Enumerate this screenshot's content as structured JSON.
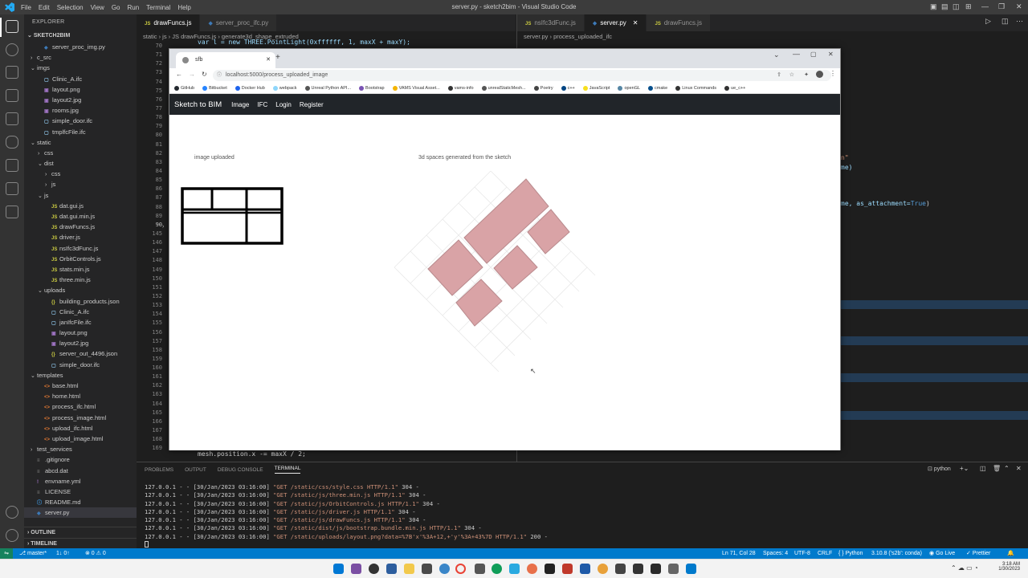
{
  "window": {
    "title": "server.py - sketch2bim - Visual Studio Code",
    "menu": [
      "File",
      "Edit",
      "Selection",
      "View",
      "Go",
      "Run",
      "Terminal",
      "Help"
    ]
  },
  "explorer": {
    "header": "EXPLORER",
    "root": "SKETCH2BIM",
    "items": [
      {
        "label": "server_proc_img.py",
        "indent": 1,
        "kind": "py",
        "chev": ""
      },
      {
        "label": "c_src",
        "indent": 0,
        "kind": "folder",
        "chev": "›"
      },
      {
        "label": "imgs",
        "indent": 0,
        "kind": "folder",
        "chev": "⌄"
      },
      {
        "label": "Clinic_A.ifc",
        "indent": 1,
        "kind": "ifc",
        "chev": ""
      },
      {
        "label": "layout.png",
        "indent": 1,
        "kind": "img",
        "chev": ""
      },
      {
        "label": "layout2.jpg",
        "indent": 1,
        "kind": "img",
        "chev": ""
      },
      {
        "label": "rooms.jpg",
        "indent": 1,
        "kind": "img",
        "chev": ""
      },
      {
        "label": "simple_door.ifc",
        "indent": 1,
        "kind": "ifc",
        "chev": ""
      },
      {
        "label": "tmplfcFile.ifc",
        "indent": 1,
        "kind": "ifc",
        "chev": ""
      },
      {
        "label": "static",
        "indent": 0,
        "kind": "folder",
        "chev": "⌄"
      },
      {
        "label": "css",
        "indent": 1,
        "kind": "folder",
        "chev": "›"
      },
      {
        "label": "dist",
        "indent": 1,
        "kind": "folder",
        "chev": "⌄"
      },
      {
        "label": "css",
        "indent": 2,
        "kind": "folder",
        "chev": "›"
      },
      {
        "label": "js",
        "indent": 2,
        "kind": "folder",
        "chev": "›"
      },
      {
        "label": "js",
        "indent": 1,
        "kind": "folder",
        "chev": "⌄"
      },
      {
        "label": "dat.gui.js",
        "indent": 2,
        "kind": "js",
        "chev": ""
      },
      {
        "label": "dat.gui.min.js",
        "indent": 2,
        "kind": "js",
        "chev": ""
      },
      {
        "label": "drawFuncs.js",
        "indent": 2,
        "kind": "js",
        "chev": ""
      },
      {
        "label": "driver.js",
        "indent": 2,
        "kind": "js",
        "chev": ""
      },
      {
        "label": "nsIfc3dFunc.js",
        "indent": 2,
        "kind": "js",
        "chev": ""
      },
      {
        "label": "OrbitControls.js",
        "indent": 2,
        "kind": "js",
        "chev": ""
      },
      {
        "label": "stats.min.js",
        "indent": 2,
        "kind": "js",
        "chev": ""
      },
      {
        "label": "three.min.js",
        "indent": 2,
        "kind": "js",
        "chev": ""
      },
      {
        "label": "uploads",
        "indent": 1,
        "kind": "folder",
        "chev": "⌄"
      },
      {
        "label": "building_products.json",
        "indent": 2,
        "kind": "json",
        "chev": ""
      },
      {
        "label": "Clinic_A.ifc",
        "indent": 2,
        "kind": "ifc",
        "chev": ""
      },
      {
        "label": "janIfcFile.ifc",
        "indent": 2,
        "kind": "ifc",
        "chev": ""
      },
      {
        "label": "layout.png",
        "indent": 2,
        "kind": "img",
        "chev": ""
      },
      {
        "label": "layout2.jpg",
        "indent": 2,
        "kind": "img",
        "chev": ""
      },
      {
        "label": "server_out_4496.json",
        "indent": 2,
        "kind": "json",
        "chev": ""
      },
      {
        "label": "simple_door.ifc",
        "indent": 2,
        "kind": "ifc",
        "chev": ""
      },
      {
        "label": "templates",
        "indent": 0,
        "kind": "folder",
        "chev": "⌄"
      },
      {
        "label": "base.html",
        "indent": 1,
        "kind": "html",
        "chev": ""
      },
      {
        "label": "home.html",
        "indent": 1,
        "kind": "html",
        "chev": ""
      },
      {
        "label": "process_ifc.html",
        "indent": 1,
        "kind": "html",
        "chev": ""
      },
      {
        "label": "process_image.html",
        "indent": 1,
        "kind": "html",
        "chev": ""
      },
      {
        "label": "upload_ifc.html",
        "indent": 1,
        "kind": "html",
        "chev": ""
      },
      {
        "label": "upload_image.html",
        "indent": 1,
        "kind": "html",
        "chev": ""
      },
      {
        "label": "test_services",
        "indent": 0,
        "kind": "folder",
        "chev": "›"
      },
      {
        "label": ".gitignore",
        "indent": 0,
        "kind": "txt",
        "chev": ""
      },
      {
        "label": "abcd.dat",
        "indent": 0,
        "kind": "txt",
        "chev": ""
      },
      {
        "label": "envname.yml",
        "indent": 0,
        "kind": "yml",
        "chev": ""
      },
      {
        "label": "LICENSE",
        "indent": 0,
        "kind": "txt",
        "chev": ""
      },
      {
        "label": "README.md",
        "indent": 0,
        "kind": "md",
        "chev": ""
      },
      {
        "label": "server.py",
        "indent": 0,
        "kind": "py",
        "chev": "",
        "selected": true
      }
    ],
    "outline": "OUTLINE",
    "timeline": "TIMELINE"
  },
  "editor_left": {
    "tabs": [
      {
        "label": "drawFuncs.js",
        "kind": "js",
        "active": true
      },
      {
        "label": "server_proc_ifc.py",
        "kind": "py",
        "active": false
      }
    ],
    "breadcrumb": "static › js › JS drawFuncs.js › generate3d_shape_extruded",
    "line_numbers": [
      "70",
      "71",
      "72",
      "73",
      "74",
      "75",
      "76",
      "77",
      "78",
      "79",
      "80",
      "81",
      "82",
      "83",
      "84",
      "85",
      "86",
      "87",
      "88",
      "89",
      "90",
      "145",
      "146",
      "147",
      "148",
      "149",
      "150",
      "151",
      "152",
      "153",
      "154",
      "155",
      "156",
      "157",
      "158",
      "159",
      "160",
      "161",
      "162",
      "163",
      "164",
      "165",
      "166",
      "167",
      "168",
      "169"
    ],
    "top_code": "var l = new THREE.PointLight(0xffffff, 1, maxX + maxY);",
    "bottom_code": "mesh.position.x -= maxX / 2;"
  },
  "editor_right": {
    "tabs": [
      {
        "label": "nsIfc3dFunc.js",
        "kind": "js",
        "active": false
      },
      {
        "label": "server.py",
        "kind": "py",
        "active": true
      },
      {
        "label": "drawFuncs.js",
        "kind": "js",
        "active": false
      }
    ],
    "breadcrumb": "server.py › process_uploaded_ifc",
    "snippet_1": "n\"",
    "snippet_2": "me)",
    "snippet_3a": "me, as_attachment=",
    "snippet_3b": "True",
    "snippet_3c": ")"
  },
  "browser": {
    "tab_title": "sfb",
    "url": "localhost:5000/process_uploaded_image",
    "bookmarks": [
      "GitHub",
      "Bitbucket",
      "Docker Hub",
      "webpack",
      "Unreal Python API...",
      "Bootstrap",
      "VAMS Visual Asset...",
      "vams-info",
      "unrealStaticMesh...",
      "Poetry",
      "c++",
      "JavaScript",
      "openGL",
      "cmake",
      "Linux Commands",
      "ue_c++"
    ],
    "brand": "Sketch to BIM",
    "nav": [
      "Image",
      "IFC",
      "Login",
      "Register"
    ],
    "label_left": "image uploaded",
    "label_right": "3d spaces generated from the sketch"
  },
  "panel": {
    "tabs": [
      "PROBLEMS",
      "OUTPUT",
      "DEBUG CONSOLE",
      "TERMINAL"
    ],
    "active_tab": "TERMINAL",
    "shell": "python",
    "log": [
      {
        "pre": "127.0.0.1 - - [30/Jan/2023 03:16:00] ",
        "req": "\"GET /static/css/style.css HTTP/1.1\"",
        "code": " 304 -"
      },
      {
        "pre": "127.0.0.1 - - [30/Jan/2023 03:16:00] ",
        "req": "\"GET /static/js/three.min.js HTTP/1.1\"",
        "code": " 304 -"
      },
      {
        "pre": "127.0.0.1 - - [30/Jan/2023 03:16:00] ",
        "req": "\"GET /static/js/OrbitControls.js HTTP/1.1\"",
        "code": " 304 -"
      },
      {
        "pre": "127.0.0.1 - - [30/Jan/2023 03:16:00] ",
        "req": "\"GET /static/js/driver.js HTTP/1.1\"",
        "code": " 304 -"
      },
      {
        "pre": "127.0.0.1 - - [30/Jan/2023 03:16:00] ",
        "req": "\"GET /static/js/drawFuncs.js HTTP/1.1\"",
        "code": " 304 -"
      },
      {
        "pre": "127.0.0.1 - - [30/Jan/2023 03:16:00] ",
        "req": "\"GET /static/dist/js/bootstrap.bundle.min.js HTTP/1.1\"",
        "code": " 304 -"
      },
      {
        "pre": "127.0.0.1 - - [30/Jan/2023 03:16:00] ",
        "req": "\"GET /static/uploads/layout.png?data=%7B'x'%3A+12,+'y'%3A+43%7D HTTP/1.1\"",
        "code": " 200 -"
      }
    ]
  },
  "status": {
    "branch": "master*",
    "sync": "1↓ 0↑",
    "problems": "⊗ 0 ⚠ 0",
    "position": "Ln 71, Col 28",
    "spaces": "Spaces: 4",
    "encoding": "UTF-8",
    "eol": "CRLF",
    "language": "Python",
    "interpreter": "3.10.8 ('s2b': conda)",
    "golive": "Go Live",
    "prettier": "Prettier"
  },
  "taskbar": {
    "time": "3:18 AM",
    "date": "1/30/2023"
  },
  "colors": {
    "accent": "#007acc",
    "navbar": "#212529",
    "room_fill": "#d9a3a6"
  }
}
